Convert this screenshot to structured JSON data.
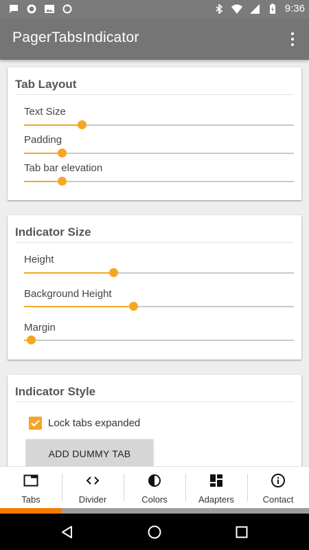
{
  "status_bar": {
    "time": "9:36",
    "left_icons": [
      "message-icon",
      "circle-icon",
      "image-icon",
      "sync-icon"
    ],
    "right_icons": [
      "bluetooth-icon",
      "wifi-icon",
      "signal-icon",
      "battery-charging-icon"
    ]
  },
  "app_bar": {
    "title": "PagerTabsIndicator",
    "overflow_icon": "more-vert-icon"
  },
  "cards": {
    "tab_layout": {
      "title": "Tab Layout",
      "settings": [
        {
          "label": "Text Size",
          "value": 0.215
        },
        {
          "label": "Padding",
          "value": 0.14
        },
        {
          "label": "Tab bar elevation",
          "value": 0.14
        }
      ]
    },
    "indicator_size": {
      "title": "Indicator Size",
      "settings": [
        {
          "label": "Height",
          "value": 0.33
        },
        {
          "label": "Background Height",
          "value": 0.405
        },
        {
          "label": "Margin",
          "value": 0.025
        }
      ]
    },
    "indicator_style": {
      "title": "Indicator Style",
      "lock_tabs": {
        "label": "Lock tabs expanded",
        "checked": true
      },
      "add_dummy_tab": "ADD DUMMY TAB"
    }
  },
  "bottom_nav": {
    "tabs": [
      {
        "label": "Tabs",
        "icon": "tab-icon"
      },
      {
        "label": "Divider",
        "icon": "code-icon"
      },
      {
        "label": "Colors",
        "icon": "contrast-icon"
      },
      {
        "label": "Adapters",
        "icon": "dashboard-icon"
      },
      {
        "label": "Contact",
        "icon": "info-icon"
      }
    ],
    "active_index": 0
  },
  "colors": {
    "accent": "#f5a623",
    "toolbar": "#757575",
    "status_bar": "#7b7b7b",
    "tab_indicator": "#f57c00",
    "tab_indicator_background": "#9e9e9e"
  },
  "system_nav": [
    "back-icon",
    "home-icon",
    "recents-icon"
  ]
}
